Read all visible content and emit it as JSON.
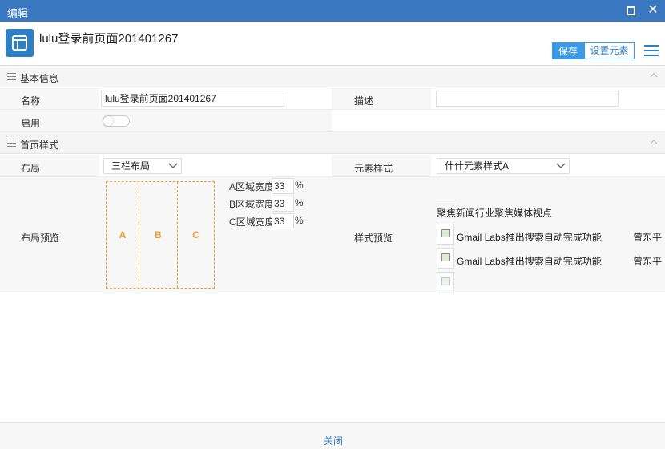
{
  "window": {
    "title": "编辑"
  },
  "header": {
    "title": "lulu登录前页面201401267",
    "save_label": "保存",
    "set_elements_label": "设置元素"
  },
  "basic": {
    "section_title": "基本信息",
    "name_label": "名称",
    "name_value": "lulu登录前页面201401267",
    "desc_label": "描述",
    "desc_value": "",
    "enable_label": "启用",
    "enabled": false
  },
  "style": {
    "section_title": "首页样式",
    "layout_label": "布局",
    "layout_value": "三栏布局",
    "element_style_label": "元素样式",
    "element_style_value": "什什元素样式A",
    "layout_preview_label": "布局预览",
    "style_preview_label": "样式预览",
    "columns": [
      "A",
      "B",
      "C"
    ],
    "widths": [
      {
        "label": "A区域宽度:",
        "value": "33",
        "unit": "%"
      },
      {
        "label": "B区域宽度:",
        "value": "33",
        "unit": "%"
      },
      {
        "label": "C区域宽度:",
        "value": "33",
        "unit": "%"
      }
    ],
    "preview_heading": "聚焦新闻行业聚焦媒体视点",
    "preview_items": [
      {
        "text": "Gmail Labs推出搜索自动完成功能",
        "author": "曾东平"
      },
      {
        "text": "Gmail Labs推出搜索自动完成功能",
        "author": "曾东平"
      }
    ]
  },
  "footer": {
    "close_label": "关闭"
  }
}
